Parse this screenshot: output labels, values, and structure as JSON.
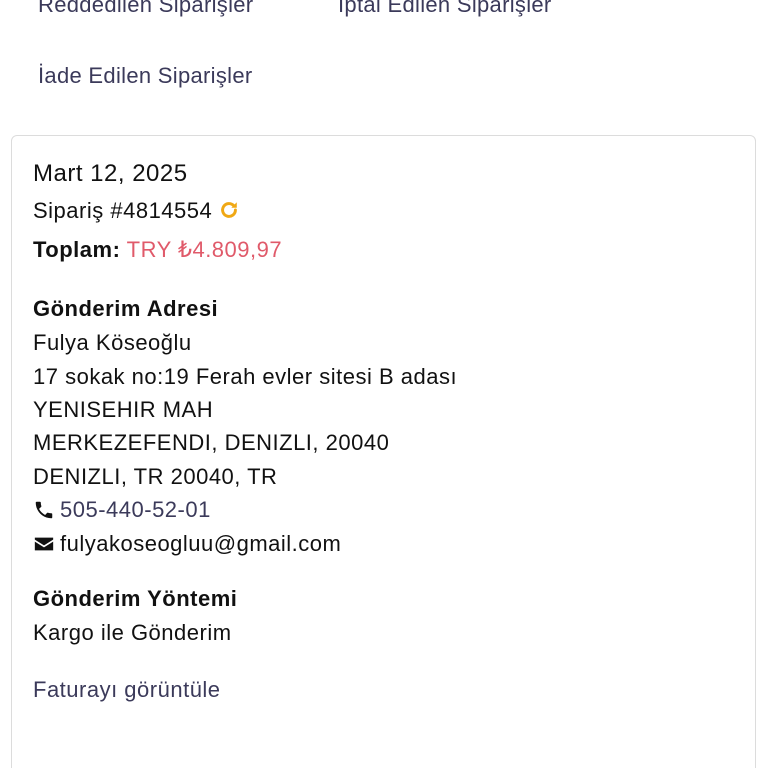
{
  "filters": {
    "rejected": "Reddedilen Siparişler",
    "cancelled": "İptal Edilen Siparişler",
    "returned": "İade Edilen Siparişler"
  },
  "order": {
    "date": "Mart 12, 2025",
    "number": "Sipariş #4814554",
    "total_label": "Toplam:",
    "total_value": "TRY ₺4.809,97"
  },
  "shipping_address": {
    "title": "Gönderim Adresi",
    "name": "Fulya Köseoğlu",
    "line1": "17 sokak no:19 Ferah evler sitesi B adası",
    "line2": "YENISEHIR MAH",
    "line3": "MERKEZEFENDI, DENIZLI, 20040",
    "line4": "DENIZLI, TR 20040, TR",
    "phone": "505-440-52-01",
    "email": "fulyakoseogluu@gmail.com"
  },
  "shipping_method": {
    "title": "Gönderim Yöntemi",
    "value": "Kargo ile Gönderim"
  },
  "invoice_link": "Faturayı görüntüle",
  "colors": {
    "link": "#3b3a5a",
    "total": "#e05a6a",
    "refresh_icon": "#f0a814",
    "card_border": "#dcdcdc"
  },
  "icons": {
    "refresh": "refresh-icon",
    "phone": "phone-icon",
    "email": "envelope-icon"
  }
}
